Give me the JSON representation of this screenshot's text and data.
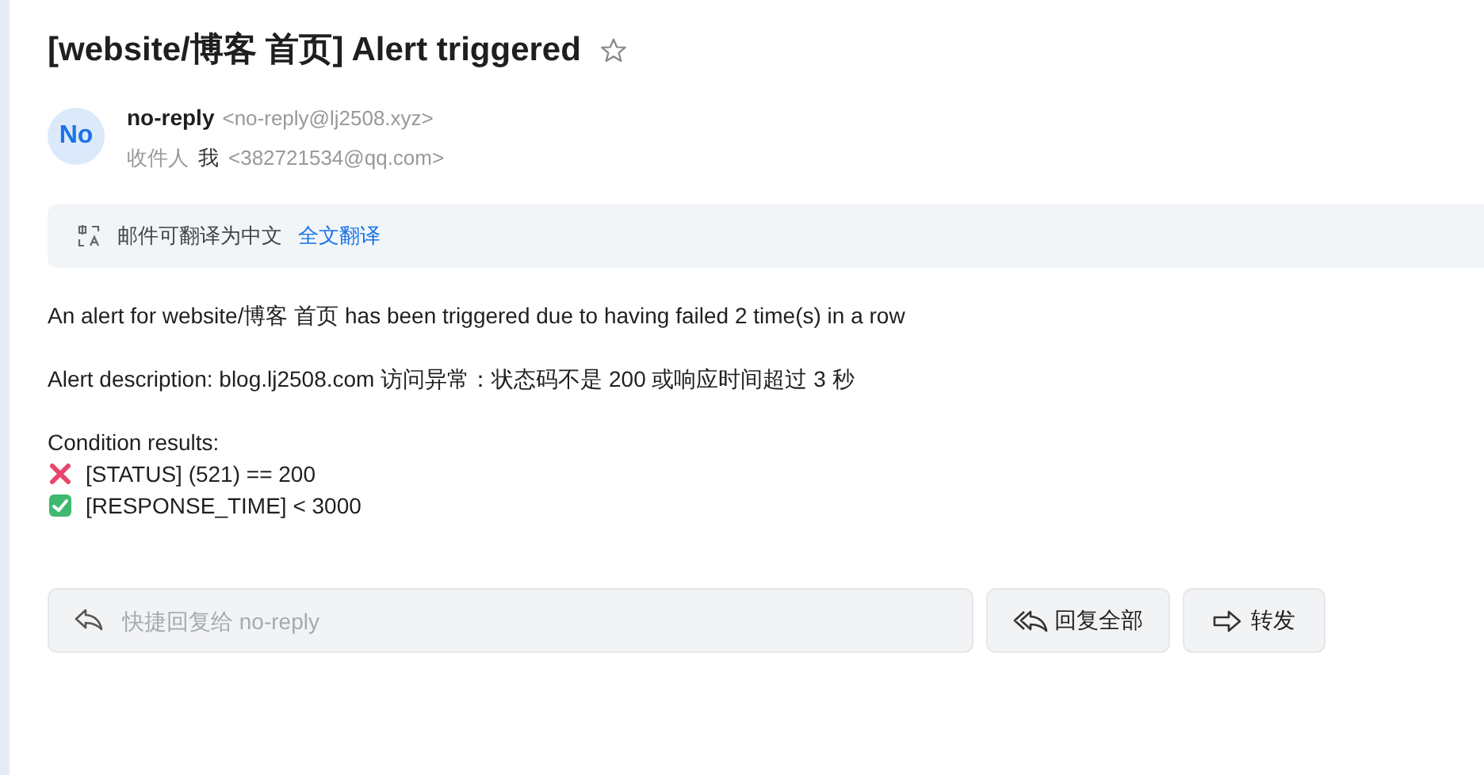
{
  "subject": "[website/博客 首页] Alert triggered",
  "starred": false,
  "sender": {
    "avatar": "No",
    "name": "no-reply",
    "address": "<no-reply@lj2508.xyz>"
  },
  "recipient": {
    "label": "收件人",
    "name": "我",
    "address": "<382721534@qq.com>"
  },
  "translate_bar": {
    "message": "邮件可翻译为中文",
    "link": "全文翻译"
  },
  "body": {
    "paragraphs": [
      "An alert for website/博客 首页 has been triggered due to having failed 2 time(s) in a row",
      "Alert description: blog.lj2508.com 访问异常：状态码不是 200 或响应时间超过 3 秒"
    ],
    "results_heading": "Condition results:",
    "results": [
      {
        "kind": "fail",
        "text": "[STATUS] (521) == 200"
      },
      {
        "kind": "pass",
        "text": "[RESPONSE_TIME] < 3000"
      }
    ]
  },
  "reply_bar": {
    "placeholder": "快捷回复给 no-reply",
    "reply_all": "回复全部",
    "forward": "转发"
  }
}
